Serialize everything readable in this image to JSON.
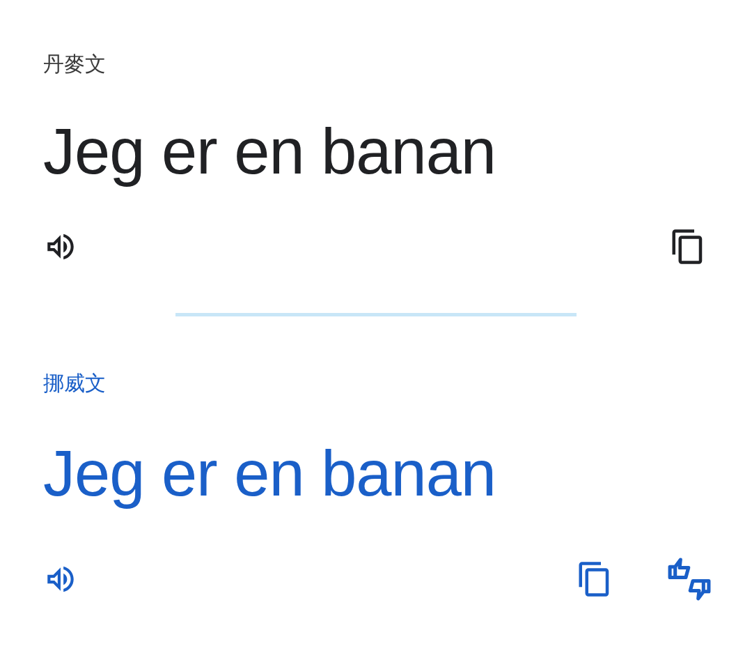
{
  "sections": [
    {
      "kind": "source",
      "language": "丹麥文",
      "text": "Jeg er en banan"
    },
    {
      "kind": "translation",
      "language": "挪威文",
      "text": "Jeg er en banan"
    }
  ]
}
